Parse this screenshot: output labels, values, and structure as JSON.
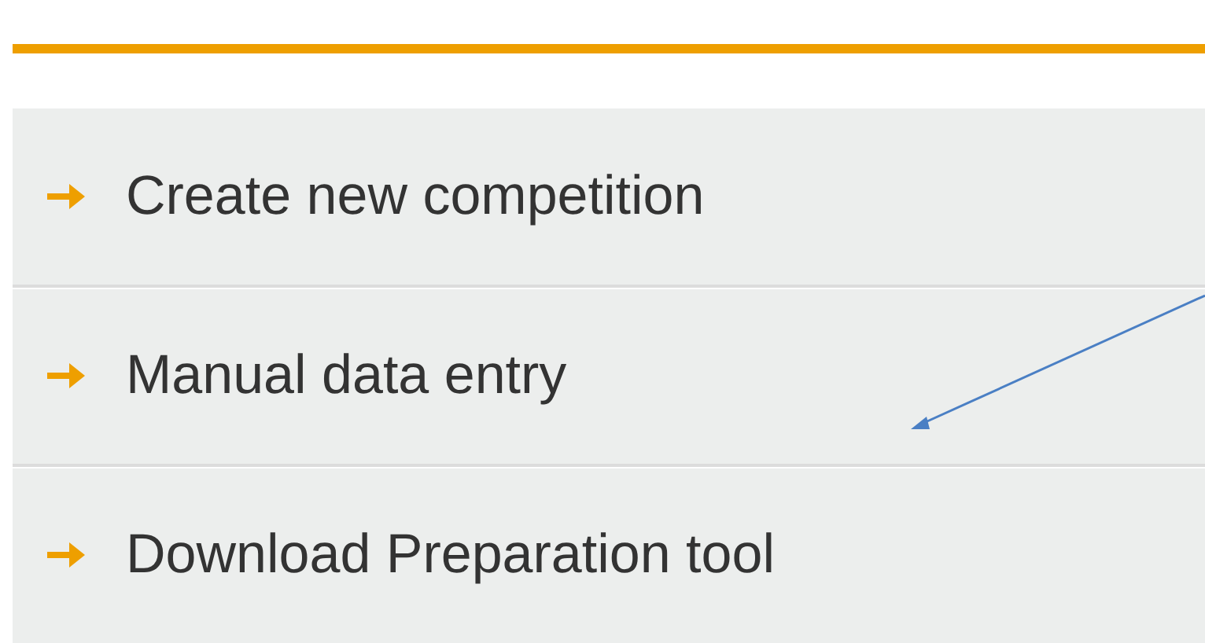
{
  "menu": {
    "items": [
      {
        "label": "Create new competition"
      },
      {
        "label": "Manual data entry"
      },
      {
        "label": "Download Preparation tool"
      }
    ]
  }
}
